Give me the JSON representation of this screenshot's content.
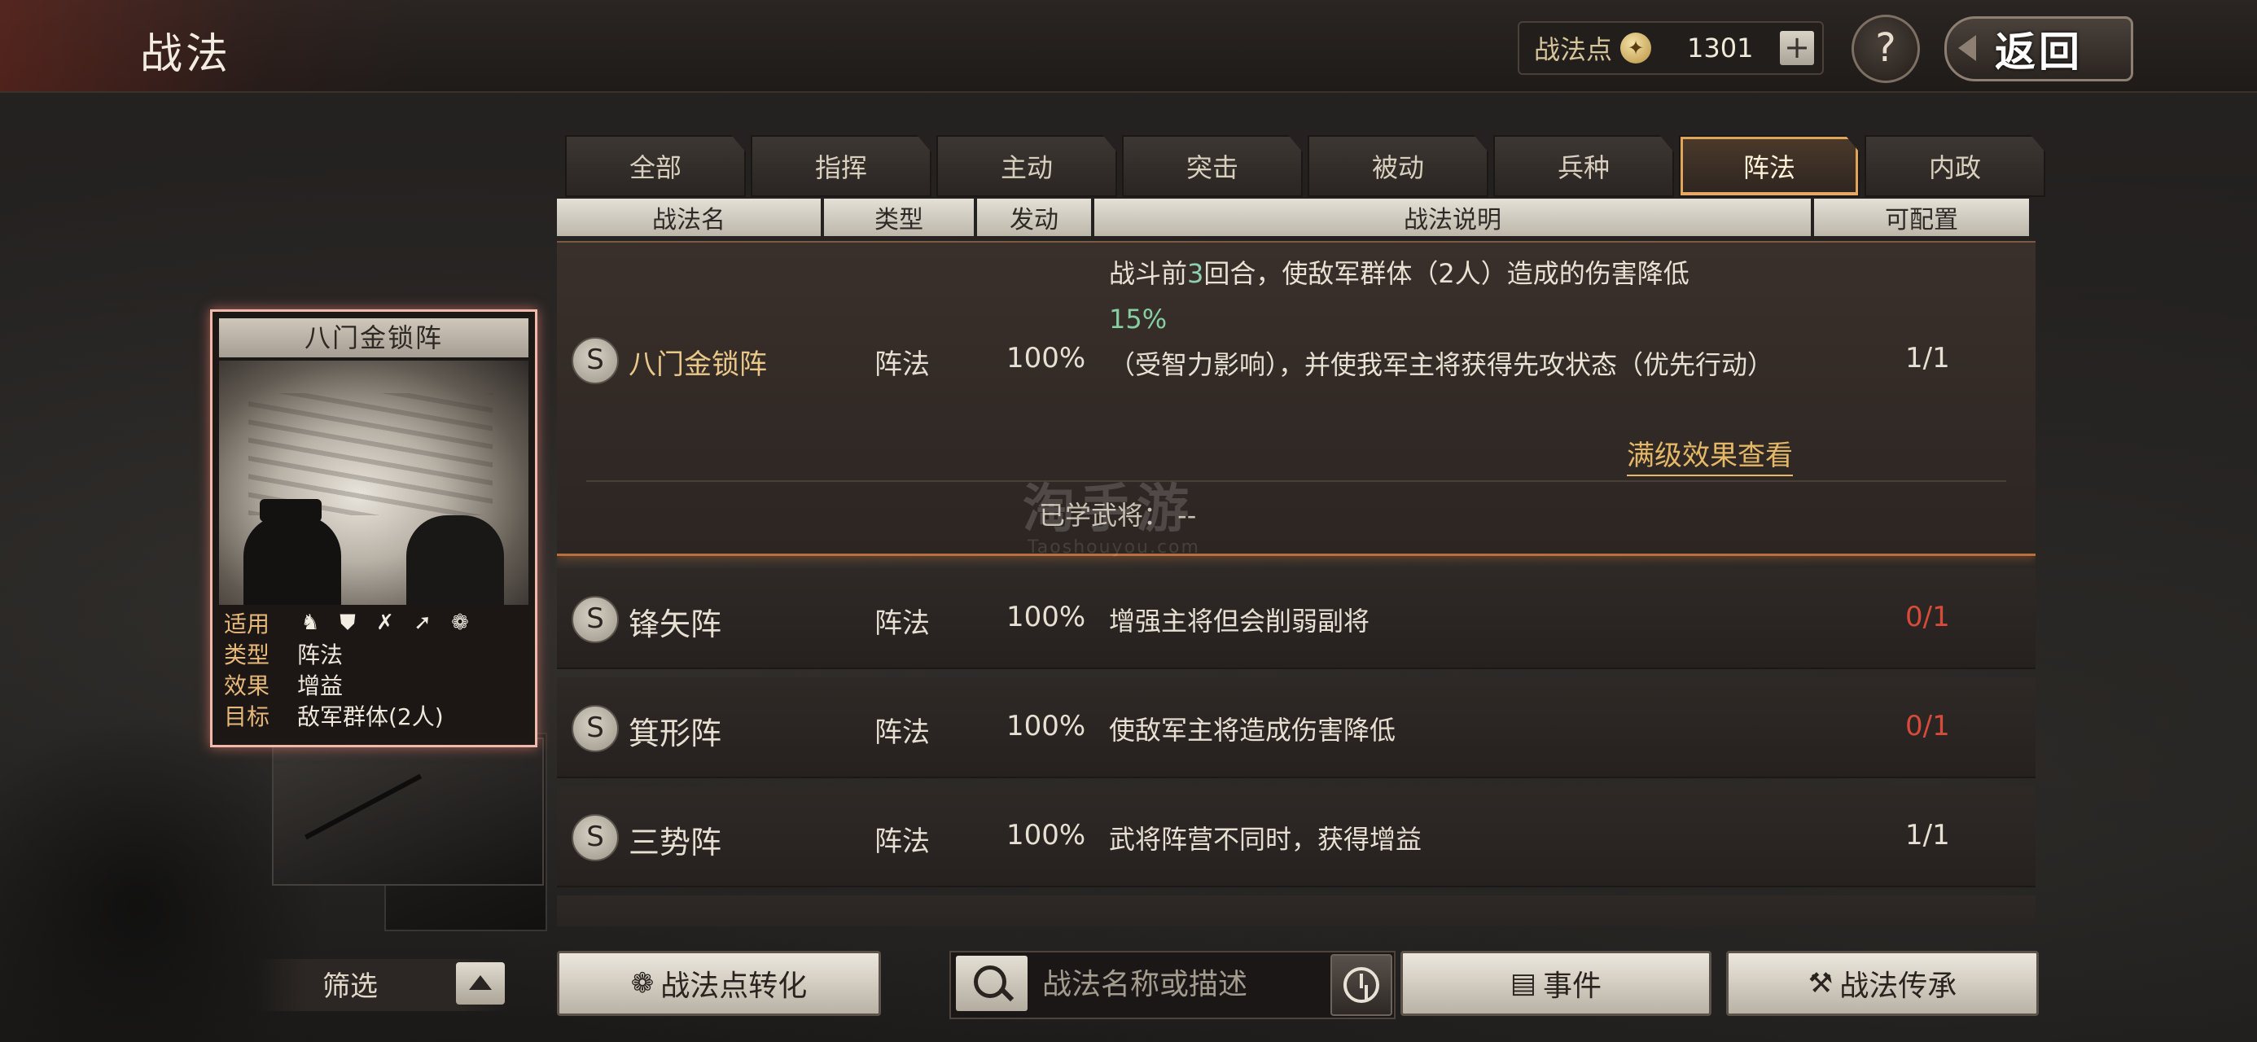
{
  "header": {
    "title": "战法",
    "points_label": "战法点",
    "points_value": "1301",
    "plus": "+",
    "help": "?",
    "back": "返回"
  },
  "tabs": [
    {
      "label": "全部"
    },
    {
      "label": "指挥"
    },
    {
      "label": "主动"
    },
    {
      "label": "突击"
    },
    {
      "label": "被动"
    },
    {
      "label": "兵种"
    },
    {
      "label": "阵法",
      "active": true
    },
    {
      "label": "内政"
    }
  ],
  "columns": {
    "name": "战法名",
    "type": "类型",
    "trigger": "发动",
    "desc": "战法说明",
    "config": "可配置"
  },
  "expanded": {
    "grade": "S",
    "name": "八门金锁阵",
    "type": "阵法",
    "rate": "100%",
    "desc_a": "战斗前",
    "desc_num": "3",
    "desc_b": "回合，使敌军群体（2人）造成的伤害降低",
    "desc_pct": "15%",
    "desc_c": "（受智力影响），并使我军主将获得先攻状态（优先行动）",
    "config": "1/1",
    "full_link": "满级效果查看",
    "learned": "已学武将：  --"
  },
  "rows": [
    {
      "grade": "S",
      "name": "锋矢阵",
      "type": "阵法",
      "rate": "100%",
      "desc": "增强主将但会削弱副将",
      "config": "0/1",
      "config_red": true
    },
    {
      "grade": "S",
      "name": "箕形阵",
      "type": "阵法",
      "rate": "100%",
      "desc": "使敌军主将造成伤害降低",
      "config": "0/1",
      "config_red": true
    },
    {
      "grade": "S",
      "name": "三势阵",
      "type": "阵法",
      "rate": "100%",
      "desc": "武将阵营不同时，获得增益",
      "config": "1/1",
      "config_red": false
    }
  ],
  "card": {
    "title": "八门金锁阵",
    "apply_key": "适用",
    "type_key": "类型",
    "type_val": "阵法",
    "effect_key": "效果",
    "effect_val": "增益",
    "target_key": "目标",
    "target_val": "敌军群体(2人)",
    "unit_icons": [
      "cavalry-icon",
      "shield-icon",
      "bow-icon",
      "spear-icon",
      "wheel-icon"
    ]
  },
  "watermark": {
    "main": "淘手游",
    "sub": "Taoshouyou.com"
  },
  "bottom": {
    "filter": "筛选",
    "convert": "战法点转化",
    "search_placeholder": "战法名称或描述",
    "events": "事件",
    "inherit": "战法传承"
  },
  "colors": {
    "accent": "#e0a45a",
    "gold_text": "#e9c88a",
    "red_count": "#d64b3a",
    "card_border": "#f1b9aa"
  }
}
